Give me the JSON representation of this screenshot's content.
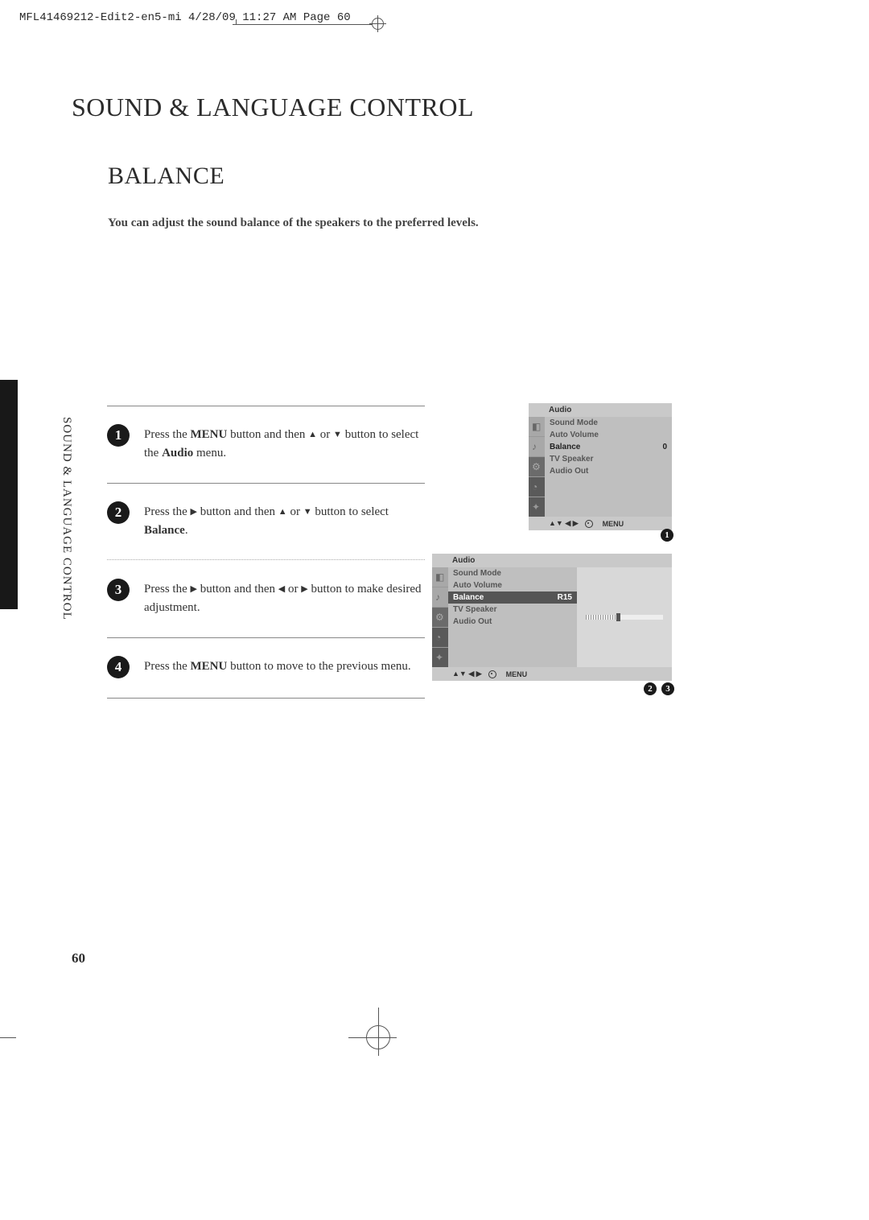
{
  "print_header": "MFL41469212-Edit2-en5-mi  4/28/09  11:27 AM  Page 60",
  "section_title": "SOUND & LANGUAGE CONTROL",
  "sub_title": "BALANCE",
  "intro": "You can adjust the sound balance of the speakers to the preferred levels.",
  "side_label": "SOUND & LANGUAGE CONTROL",
  "steps": {
    "1": {
      "num": "1",
      "pre": "Press the ",
      "b1": "MENU",
      "mid1": " button and then ",
      "ar1": "▲",
      "or": " or ",
      "ar2": "▼",
      "mid2": " button to select the ",
      "b2": "Audio",
      "post": " menu."
    },
    "2": {
      "num": "2",
      "pre": "Press the ",
      "ar1": "▶",
      "mid1": " button and then ",
      "ar2": "▲",
      "or": " or ",
      "ar3": "▼",
      "mid2": " button to select ",
      "b1": "Balance",
      "post": "."
    },
    "3": {
      "num": "3",
      "pre": "Press the  ",
      "ar1": "▶",
      "mid1": " button and then ",
      "ar2": "◀",
      "or": " or ",
      "ar3": "▶",
      "post": " button to make desired adjustment."
    },
    "4": {
      "num": "4",
      "pre": "Press the ",
      "b1": "MENU",
      "post": " button to move to the previous menu."
    }
  },
  "osd1": {
    "title": "Audio",
    "items": [
      "Sound Mode",
      "Auto Volume",
      "Balance",
      "TV Speaker",
      "Audio Out"
    ],
    "selected_index": 2,
    "value": "0",
    "footer_nav": "▲▼   ◀ ▶",
    "footer_menu": "MENU"
  },
  "osd2": {
    "title": "Audio",
    "items": [
      "Sound Mode",
      "Auto Volume",
      "Balance",
      "TV Speaker",
      "Audio Out"
    ],
    "selected_index": 2,
    "value": "R15",
    "footer_nav": "▲▼   ◀ ▶",
    "footer_menu": "MENU"
  },
  "callouts": {
    "c1": "1",
    "c2": "2",
    "c3": "3"
  },
  "page_number": "60"
}
